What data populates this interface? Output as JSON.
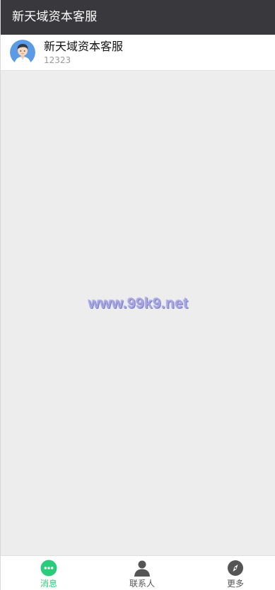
{
  "header": {
    "title": "新天域资本客服"
  },
  "chat_list": [
    {
      "name": "新天域资本客服",
      "preview": "12323",
      "avatar_icon": "male-user-avatar-icon"
    }
  ],
  "watermark": {
    "text": "www.99k9.net"
  },
  "tabbar": {
    "tabs": [
      {
        "label": "消息",
        "icon": "chat-bubble-icon",
        "active": true
      },
      {
        "label": "联系人",
        "icon": "person-icon",
        "active": false
      },
      {
        "label": "更多",
        "icon": "compass-icon",
        "active": false
      }
    ]
  },
  "colors": {
    "header_bg": "#38383d",
    "accent": "#2bcb7c",
    "page_bg": "#ededed"
  }
}
